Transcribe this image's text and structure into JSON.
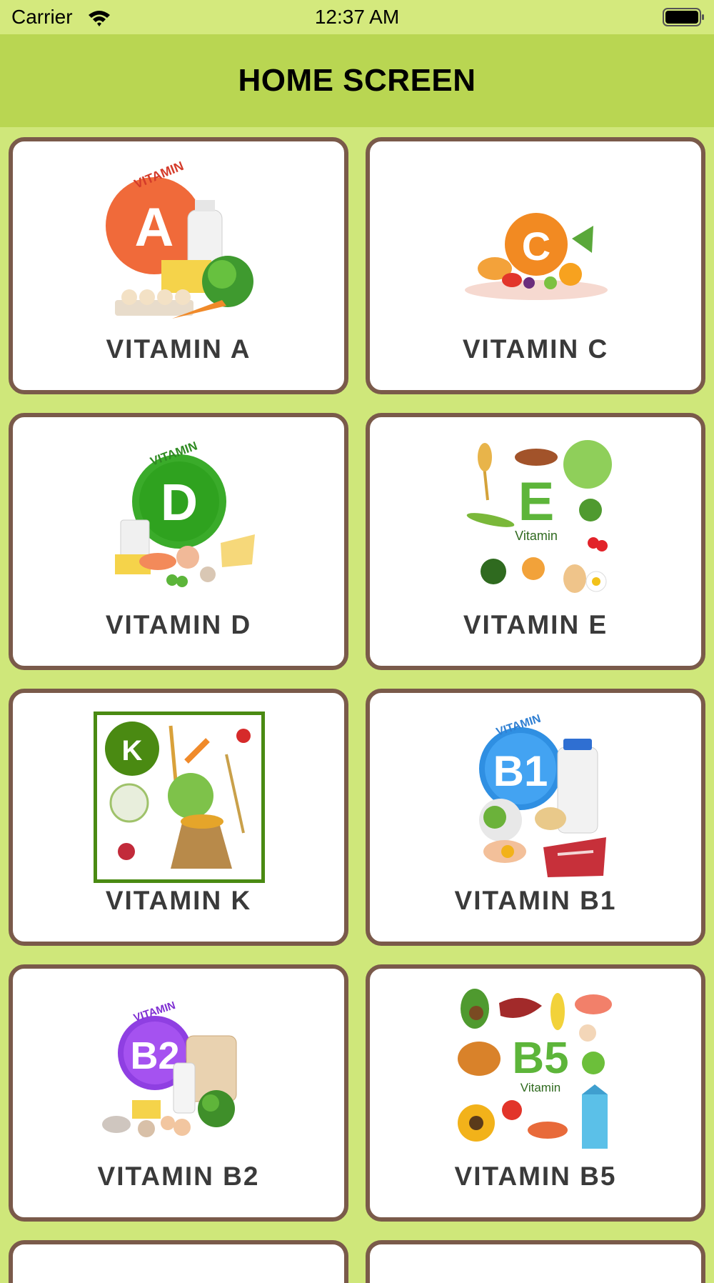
{
  "status_bar": {
    "carrier": "Carrier",
    "time": "12:37 AM"
  },
  "header": {
    "title": "HOME SCREEN"
  },
  "colors": {
    "background": "#cfe77a",
    "header": "#b9d652",
    "card_border": "#7a5a4a",
    "label": "#3a3a3a"
  },
  "cards": [
    {
      "label": "VITAMIN A",
      "badge": "A",
      "badge_word": "VITAMIN",
      "icon": "vitamin-a-foods-icon"
    },
    {
      "label": "VITAMIN C",
      "badge": "C",
      "icon": "vitamin-c-fruits-icon"
    },
    {
      "label": "VITAMIN D",
      "badge": "D",
      "badge_word": "VITAMIN",
      "icon": "vitamin-d-foods-icon"
    },
    {
      "label": "VITAMIN E",
      "badge": "E",
      "badge_word": "Vitamin",
      "icon": "vitamin-e-foods-icon"
    },
    {
      "label": "VITAMIN K",
      "badge": "K",
      "icon": "vitamin-k-foods-icon"
    },
    {
      "label": "VITAMIN B1",
      "badge": "B1",
      "badge_word": "VITAMIN",
      "icon": "vitamin-b1-foods-icon"
    },
    {
      "label": "VITAMIN B2",
      "badge": "B2",
      "badge_word": "VITAMIN",
      "icon": "vitamin-b2-foods-icon"
    },
    {
      "label": "VITAMIN B5",
      "badge": "B5",
      "badge_word": "Vitamin",
      "icon": "vitamin-b5-foods-icon"
    }
  ]
}
